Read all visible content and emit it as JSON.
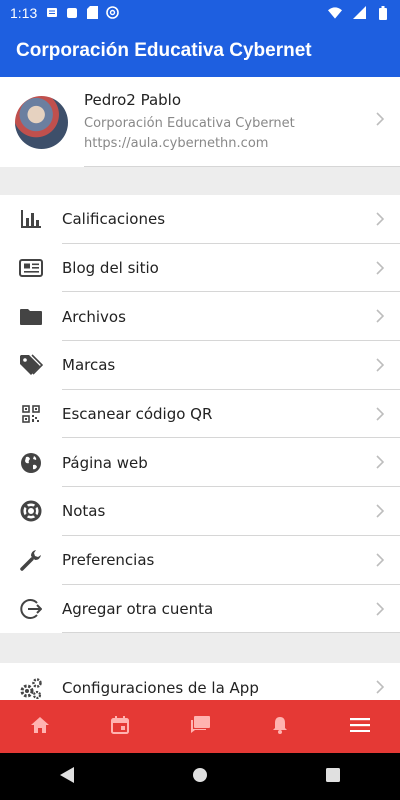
{
  "status_bar": {
    "time": "1:13",
    "left_icons": [
      "message-icon",
      "notification-icon",
      "sd-card-icon",
      "at-sign-icon"
    ],
    "right_icons": [
      "wifi-icon",
      "signal-icon",
      "battery-icon"
    ]
  },
  "app_bar": {
    "title": "Corporación Educativa Cybernet"
  },
  "profile": {
    "name": "Pedro2 Pablo",
    "organization": "Corporación Educativa Cybernet",
    "url": "https://aula.cybernethn.com"
  },
  "menu": {
    "items": [
      {
        "label": "Calificaciones",
        "icon": "bar-chart-icon"
      },
      {
        "label": "Blog del sitio",
        "icon": "newspaper-icon"
      },
      {
        "label": "Archivos",
        "icon": "folder-icon"
      },
      {
        "label": "Marcas",
        "icon": "tags-icon"
      },
      {
        "label": "Escanear código QR",
        "icon": "qr-code-icon"
      },
      {
        "label": "Página web",
        "icon": "globe-icon"
      },
      {
        "label": "Notas",
        "icon": "life-ring-icon"
      },
      {
        "label": "Preferencias",
        "icon": "wrench-icon"
      },
      {
        "label": "Agregar otra cuenta",
        "icon": "sign-out-icon"
      }
    ]
  },
  "settings": {
    "label": "Configuraciones de la App",
    "icon": "cogs-icon"
  },
  "bottom_nav": {
    "items": [
      "home-icon",
      "calendar-icon",
      "messages-icon",
      "bell-icon",
      "menu-icon"
    ],
    "color": "#e53935"
  },
  "colors": {
    "primary": "#1e5fe0",
    "accent": "#e53935"
  }
}
